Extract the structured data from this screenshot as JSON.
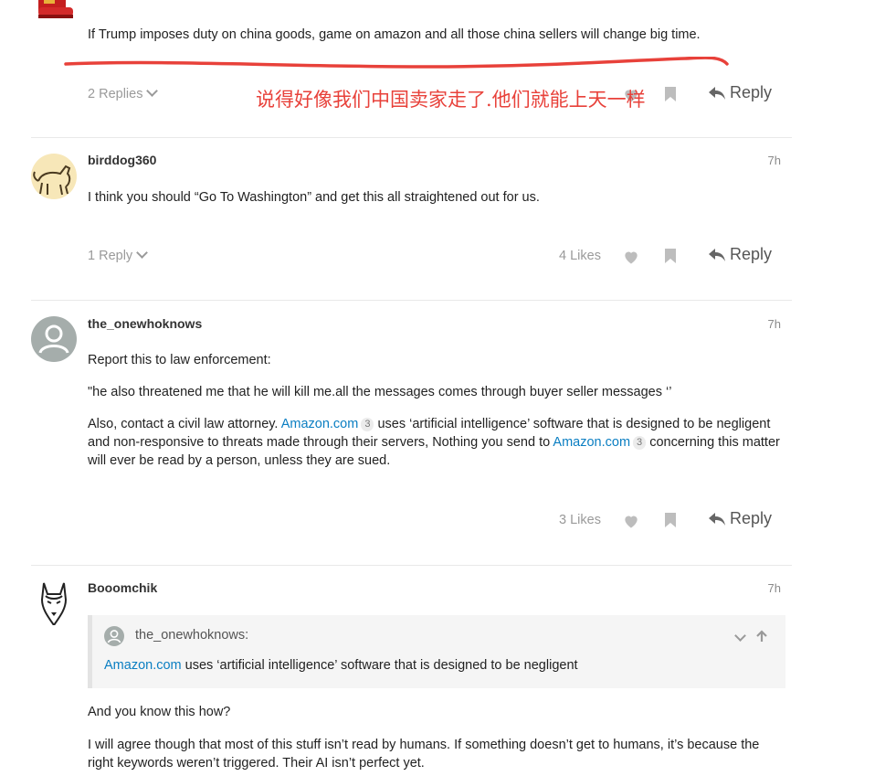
{
  "posts": [
    {
      "username": "",
      "time": "",
      "body": [
        "If Trump imposes duty on china goods, game on amazon and all those china sellers will change big time."
      ],
      "replies_label": "2 Replies",
      "likes": "",
      "reply_label": "Reply"
    },
    {
      "username": "birddog360",
      "time": "7h",
      "body": [
        "I think you should “Go To Washington” and get this all straightened out for us."
      ],
      "replies_label": "1 Reply",
      "likes": "4 Likes",
      "reply_label": "Reply"
    },
    {
      "username": "the_onewhoknows",
      "time": "7h",
      "body": [
        "Report this to law enforcement:",
        "\"he also threatened me that he will kill me.all the messages comes through buyer seller messages ‘’"
      ],
      "body3": {
        "pre": "Also, contact a civil law attorney. ",
        "link1": "Amazon.com",
        "badge1": "3",
        "mid": " uses ‘artificial intelligence’ software that is designed to be negligent and non-responsive to threats made through their servers, Nothing you send to ",
        "link2": "Amazon.com",
        "badge2": "3",
        "post": " concerning this matter will ever be read by a person, unless they are sued."
      },
      "likes": "3 Likes",
      "reply_label": "Reply"
    },
    {
      "username": "Booomchik",
      "time": "7h",
      "quote": {
        "author": "the_onewhoknows:",
        "link": "Amazon.com",
        "text": " uses ‘artificial intelligence’ software that is designed to be negligent"
      },
      "body": [
        "And you know this how?",
        "I will agree though that most of this stuff isn’t read by humans. If something doesn’t get to humans, it’s because the right keywords weren’t triggered. Their AI isn’t perfect yet."
      ]
    }
  ],
  "annotation": {
    "text": "说得好像我们中国卖家走了.他们就能上天一样",
    "color": "#e8413a"
  },
  "colors": {
    "link": "#0a7ec2",
    "muted": "#9a9a9a"
  }
}
